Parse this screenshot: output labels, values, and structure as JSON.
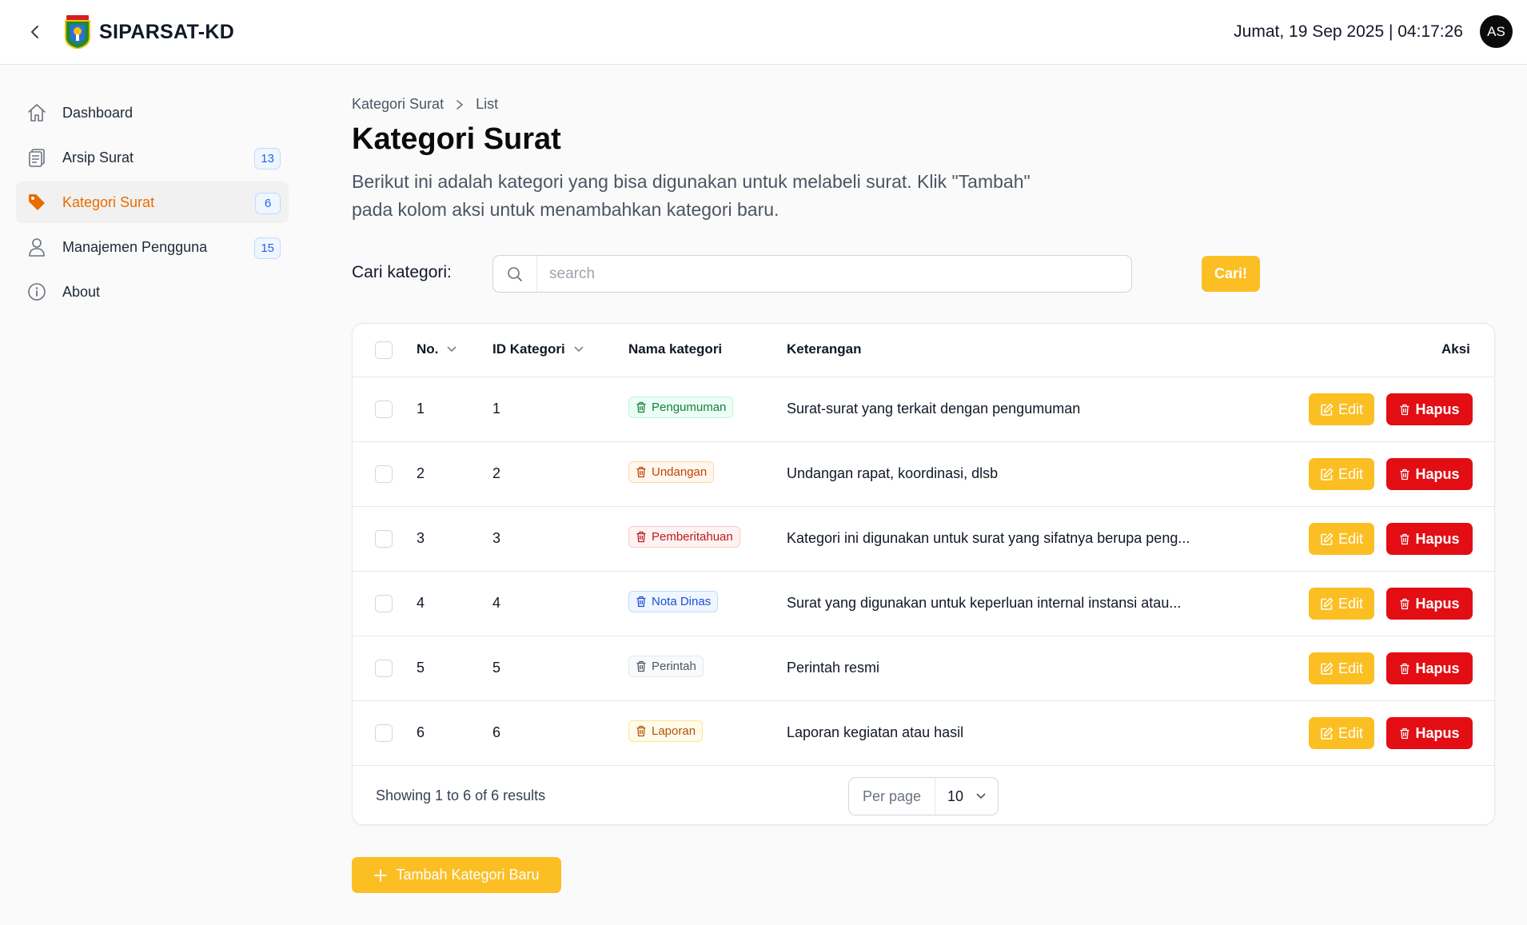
{
  "header": {
    "app_title": "SIPARSAT-KD",
    "datetime": "Jumat, 19 Sep 2025 | 04:17:26",
    "avatar_initials": "AS"
  },
  "sidebar": {
    "items": [
      {
        "label": "Dashboard",
        "icon": "home-icon",
        "badge": null,
        "active": false
      },
      {
        "label": "Arsip Surat",
        "icon": "clipboard-icon",
        "badge": "13",
        "active": false
      },
      {
        "label": "Kategori Surat",
        "icon": "tag-icon",
        "badge": "6",
        "active": true
      },
      {
        "label": "Manajemen Pengguna",
        "icon": "user-icon",
        "badge": "15",
        "active": false
      },
      {
        "label": "About",
        "icon": "info-icon",
        "badge": null,
        "active": false
      }
    ]
  },
  "breadcrumb": {
    "parent": "Kategori Surat",
    "current": "List"
  },
  "page": {
    "title": "Kategori Surat",
    "description": "Berikut ini adalah kategori yang bisa digunakan untuk melabeli surat. Klik \"Tambah\" pada kolom aksi untuk menambahkan kategori baru."
  },
  "search": {
    "label": "Cari kategori:",
    "placeholder": "search",
    "value": "",
    "button_label": "Cari!"
  },
  "table": {
    "columns": {
      "no": "No.",
      "id": "ID Kategori",
      "name": "Nama kategori",
      "desc": "Keterangan",
      "actions": "Aksi"
    },
    "edit_label": "Edit",
    "delete_label": "Hapus",
    "rows": [
      {
        "no": "1",
        "id": "1",
        "name": "Pengumuman",
        "desc": "Surat-surat yang terkait dengan pengumuman",
        "chip": "green"
      },
      {
        "no": "2",
        "id": "2",
        "name": "Undangan",
        "desc": "Undangan rapat, koordinasi, dlsb",
        "chip": "orange"
      },
      {
        "no": "3",
        "id": "3",
        "name": "Pemberitahuan",
        "desc": "Kategori ini digunakan untuk surat yang sifatnya berupa peng...",
        "chip": "red"
      },
      {
        "no": "4",
        "id": "4",
        "name": "Nota Dinas",
        "desc": "Surat yang digunakan untuk keperluan internal instansi atau...",
        "chip": "blue"
      },
      {
        "no": "5",
        "id": "5",
        "name": "Perintah",
        "desc": "Perintah resmi",
        "chip": "gray"
      },
      {
        "no": "6",
        "id": "6",
        "name": "Laporan",
        "desc": "Laporan kegiatan atau hasil",
        "chip": "amber"
      }
    ],
    "footer": {
      "showing": "Showing 1 to 6 of 6 results",
      "per_page_label": "Per page",
      "per_page_value": "10"
    }
  },
  "add_button_label": "Tambah Kategori Baru",
  "colors": {
    "accent": "#fbbf24",
    "danger": "#e30d14",
    "active_nav": "#ea6c00",
    "badge": "#2563eb"
  }
}
